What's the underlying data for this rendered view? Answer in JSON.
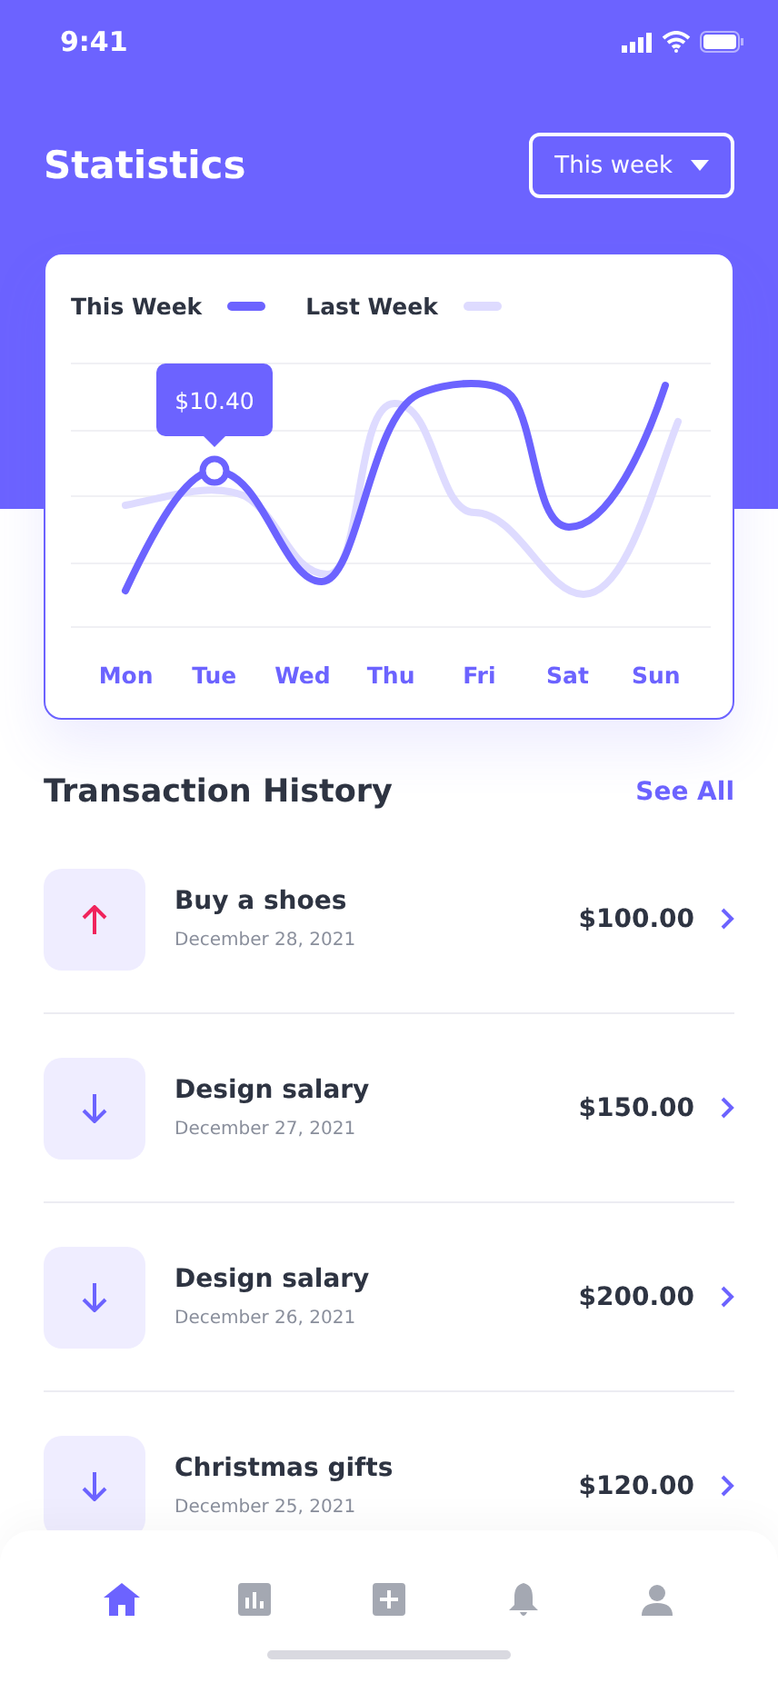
{
  "status_bar": {
    "time": "9:41"
  },
  "header": {
    "title": "Statistics",
    "period": "This week"
  },
  "chart": {
    "legend": [
      {
        "label": "This Week",
        "kind": "current"
      },
      {
        "label": "Last Week",
        "kind": "previous"
      }
    ],
    "tooltip": "$10.40",
    "days": [
      "Mon",
      "Tue",
      "Wed",
      "Thu",
      "Fri",
      "Sat",
      "Sun"
    ]
  },
  "transactions": {
    "title": "Transaction History",
    "link": "See All",
    "items": [
      {
        "kind": "outgoing",
        "name": "Buy a shoes",
        "date": "December 28, 2021",
        "amount": "$100.00"
      },
      {
        "kind": "incoming",
        "name": "Design salary",
        "date": "December 27, 2021",
        "amount": "$150.00"
      },
      {
        "kind": "incoming",
        "name": "Design salary",
        "date": "December 26, 2021",
        "amount": "$200.00"
      },
      {
        "kind": "incoming",
        "name": "Christmas gifts",
        "date": "December 25, 2021",
        "amount": "$120.00"
      }
    ]
  },
  "nav": [
    {
      "kind": "home",
      "selected": true
    },
    {
      "kind": "stats",
      "selected": false
    },
    {
      "kind": "add",
      "selected": false
    },
    {
      "kind": "bell",
      "selected": false
    },
    {
      "kind": "profile",
      "selected": false
    }
  ]
}
